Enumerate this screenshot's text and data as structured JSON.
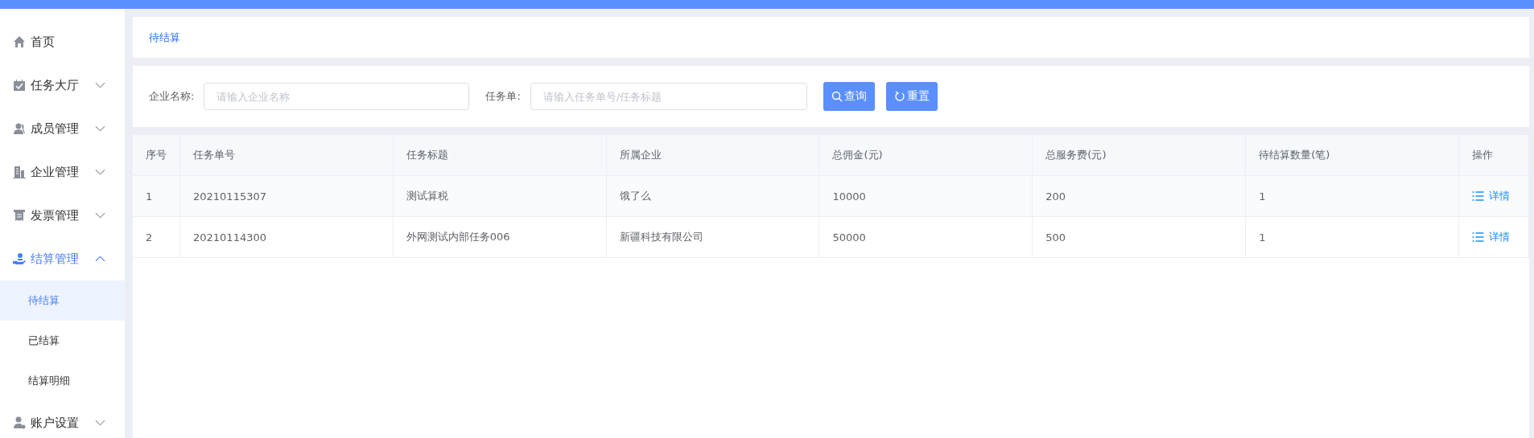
{
  "sidebar": {
    "items": [
      {
        "label": "首页",
        "selected": false
      },
      {
        "label": "任务大厅",
        "expanded": false,
        "selected": false
      },
      {
        "label": "成员管理",
        "expanded": false,
        "selected": false
      },
      {
        "label": "企业管理",
        "expanded": false,
        "selected": false
      },
      {
        "label": "发票管理",
        "expanded": false,
        "selected": false
      },
      {
        "label": "结算管理",
        "expanded": true,
        "selected": true,
        "children": [
          {
            "label": "待结算",
            "selected": true
          },
          {
            "label": "已结算",
            "selected": false
          },
          {
            "label": "结算明细",
            "selected": false
          }
        ]
      },
      {
        "label": "账户设置",
        "expanded": false,
        "selected": false
      }
    ]
  },
  "breadcrumb": "待结算",
  "filters": {
    "fields": [
      {
        "label": "企业名称:",
        "placeholder": "请输入企业名称"
      },
      {
        "label": "任务单:",
        "placeholder": "请输入任务单号/任务标题"
      }
    ],
    "buttons": [
      {
        "label": "查询",
        "kind": "search"
      },
      {
        "label": "重置",
        "kind": "reset"
      }
    ]
  },
  "table": {
    "columns": [
      "序号",
      "任务单号",
      "任务标题",
      "所属企业",
      "总佣金(元)",
      "总服务费(元)",
      "待结算数量(笔)",
      "操作"
    ],
    "rows": [
      {
        "cells": [
          "1",
          "20210115307",
          "测试算税",
          "饿了么",
          "10000",
          "200",
          "1"
        ],
        "action": "详情"
      },
      {
        "cells": [
          "2",
          "20210114300",
          "外网测试内部任务006",
          "新疆科技有限公司",
          "50000",
          "500",
          "1"
        ],
        "action": "详情"
      }
    ]
  }
}
